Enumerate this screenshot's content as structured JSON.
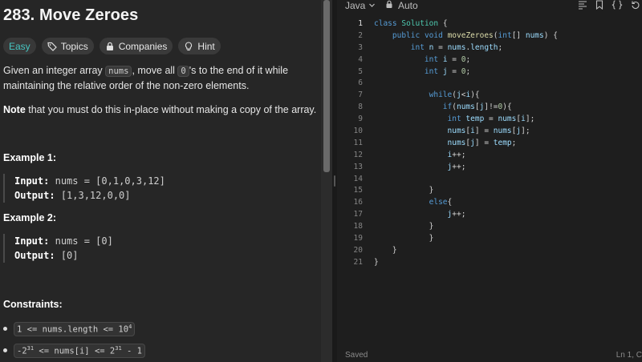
{
  "problem": {
    "title": "283. Move Zeroes",
    "tags": {
      "difficulty": "Easy",
      "topics": "Topics",
      "companies": "Companies",
      "hint": "Hint"
    },
    "desc": {
      "p1_a": "Given an integer array ",
      "p1_code1": "nums",
      "p1_b": ", move all ",
      "p1_code2": "0",
      "p1_c": "'s to the end of it while maintaining the relative order of the non-zero elements.",
      "p2_bold": "Note",
      "p2_rest": " that you must do this in-place without making a copy of the array."
    },
    "examples": [
      {
        "title": "Example 1:",
        "input_label": "Input:",
        "input": "nums = [0,1,0,3,12]",
        "output_label": "Output:",
        "output": "[1,3,12,0,0]"
      },
      {
        "title": "Example 2:",
        "input_label": "Input:",
        "input": "nums = [0]",
        "output_label": "Output:",
        "output": "[0]"
      }
    ],
    "constraints_title": "Constraints:",
    "constraints": [
      {
        "text": "1 <= nums.length <= 10",
        "sup": "4"
      },
      {
        "pre": "-2",
        "pre_sup": "31",
        "mid": " <= nums[i] <= 2",
        "post_sup": "31",
        "post": " - 1"
      }
    ]
  },
  "editor": {
    "language": "Java",
    "mode": "Auto",
    "status_saved": "Saved",
    "cursor": "Ln 1, C",
    "line_numbers": [
      "1",
      "2",
      "3",
      "4",
      "5",
      "6",
      "7",
      "8",
      "9",
      "10",
      "11",
      "12",
      "13",
      "14",
      "15",
      "16",
      "17",
      "18",
      "19",
      "20",
      "21"
    ],
    "lines": [
      "class Solution {",
      "    public void moveZeroes(int[] nums) {",
      "        int n = nums.length;",
      "           int i = 0;",
      "           int j = 0;",
      "",
      "            while(j<i){",
      "               if(nums[j]!=0){",
      "                int temp = nums[i];",
      "                nums[i] = nums[j];",
      "                nums[j] = temp;",
      "                i++;",
      "                j++;",
      "",
      "            }",
      "            else{",
      "                j++;",
      "            }",
      "            }",
      "    }",
      "}"
    ]
  },
  "colors": {
    "easy": "#46c6c2",
    "keyword": "#569cd6",
    "type": "#4ec9b0",
    "function": "#dcdcaa",
    "variable": "#9cdcfe",
    "number": "#b5cea8"
  },
  "icons": [
    "tag-icon",
    "lock-icon",
    "lightbulb-icon",
    "chevron-down-icon",
    "format-icon",
    "bookmark-icon",
    "braces-icon",
    "reset-icon"
  ]
}
